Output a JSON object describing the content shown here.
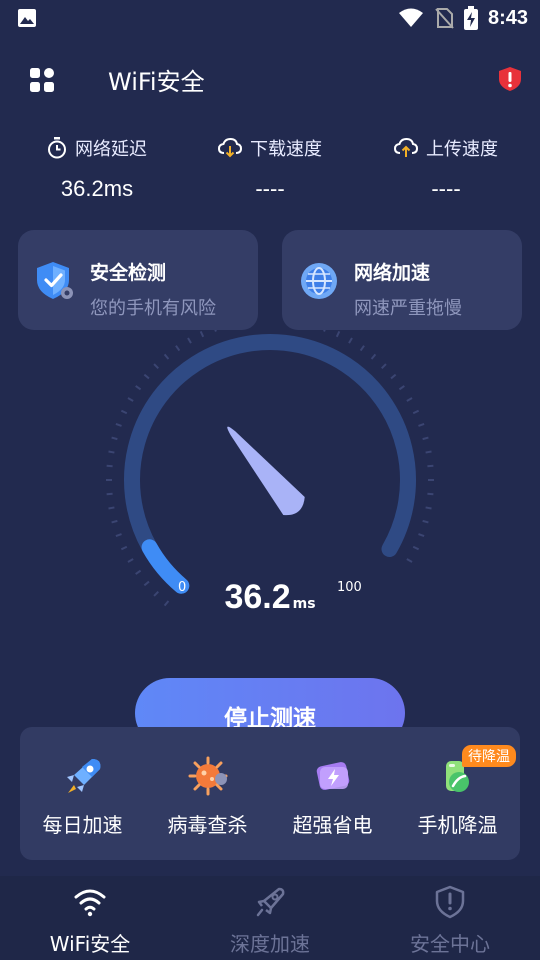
{
  "status_bar": {
    "time": "8:43"
  },
  "header": {
    "title": "WiFi安全",
    "icons": [
      "grid-apps-icon",
      "shield-alert-icon"
    ]
  },
  "metrics": [
    {
      "label": "网络延迟",
      "value": "36.2ms",
      "icon": "timer-icon"
    },
    {
      "label": "下载速度",
      "value": "----",
      "icon": "cloud-download-icon"
    },
    {
      "label": "上传速度",
      "value": "----",
      "icon": "cloud-upload-icon"
    }
  ],
  "cards": [
    {
      "title": "安全检测",
      "subtitle": "您的手机有风险",
      "icon": "security-shield-icon"
    },
    {
      "title": "网络加速",
      "subtitle": "网速严重拖慢",
      "icon": "globe-icon"
    }
  ],
  "gauge": {
    "min_label": "0",
    "max_label": "100",
    "value": "36.2",
    "unit": "ms",
    "progress_fraction": 0.08,
    "colors": {
      "active": "#3f8cf5",
      "track": "#2f4a84",
      "needle": "#a9b3f7"
    }
  },
  "action": {
    "label": "停止测速"
  },
  "tools": [
    {
      "label": "每日加速",
      "icon": "rocket-boost-icon"
    },
    {
      "label": "病毒查杀",
      "icon": "virus-scan-icon"
    },
    {
      "label": "超强省电",
      "icon": "battery-save-icon"
    },
    {
      "label": "手机降温",
      "icon": "thermometer-cool-icon",
      "badge": "待降温"
    }
  ],
  "bottom_nav": [
    {
      "label": "WiFi安全",
      "icon": "wifi-icon",
      "active": true
    },
    {
      "label": "深度加速",
      "icon": "rocket-icon",
      "active": false
    },
    {
      "label": "安全中心",
      "icon": "shield-exclamation-icon",
      "active": false
    }
  ]
}
